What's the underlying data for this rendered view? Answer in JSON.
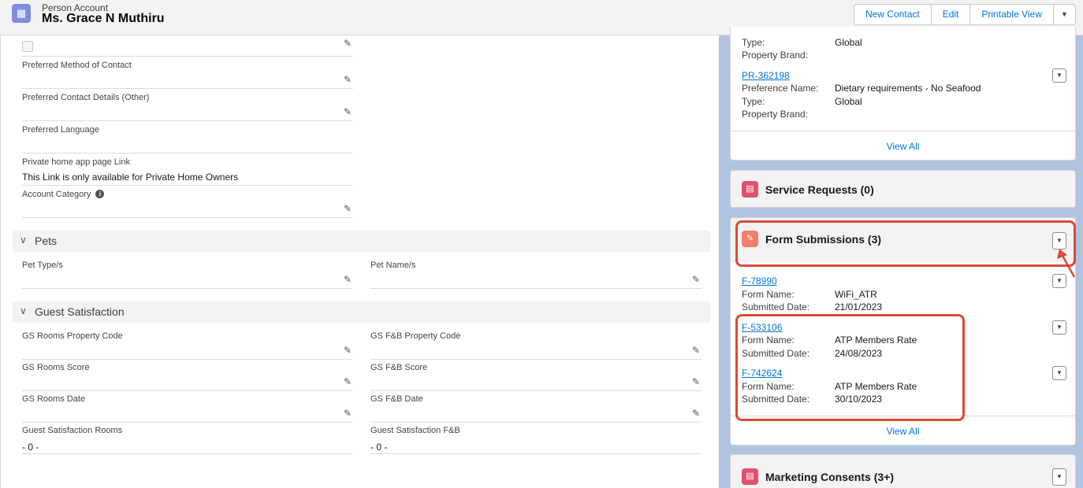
{
  "header": {
    "object_type": "Person Account",
    "record_name": "Ms. Grace N Muthiru",
    "buttons": [
      "New Contact",
      "Edit",
      "Printable View"
    ]
  },
  "details": {
    "fields": [
      {
        "label": "Preferred Method of Contact",
        "value": ""
      },
      {
        "label": "Preferred Contact Details (Other)",
        "value": ""
      },
      {
        "label": "Preferred Language",
        "value": ""
      },
      {
        "label": "Private home app page Link",
        "value": "This Link is only available for Private Home Owners"
      },
      {
        "label": "Account Category",
        "value": ""
      }
    ],
    "pets": {
      "title": "Pets",
      "fields": [
        {
          "label": "Pet Type/s",
          "value": ""
        },
        {
          "label": "Pet Name/s",
          "value": ""
        }
      ]
    },
    "guest_satisfaction": {
      "title": "Guest Satisfaction",
      "fields": [
        {
          "label": "GS Rooms Property Code",
          "value": ""
        },
        {
          "label": "GS F&B Property Code",
          "value": ""
        },
        {
          "label": "GS Rooms Score",
          "value": ""
        },
        {
          "label": "GS F&B Score",
          "value": ""
        },
        {
          "label": "GS Rooms Date",
          "value": ""
        },
        {
          "label": "GS F&B Date",
          "value": ""
        },
        {
          "label": "Guest Satisfaction Rooms",
          "value": "- 0 -"
        },
        {
          "label": "Guest Satisfaction F&B",
          "value": "- 0 -"
        }
      ]
    }
  },
  "preferences_card": {
    "top_item": {
      "type_label": "Type:",
      "type_value": "Global",
      "brand_label": "Property Brand:"
    },
    "item": {
      "id": "PR-362198",
      "name_label": "Preference Name:",
      "name_value": "Dietary requirements - No Seafood",
      "type_label": "Type:",
      "type_value": "Global",
      "brand_label": "Property Brand:"
    },
    "view_all": "View All"
  },
  "service_requests": {
    "title": "Service Requests (0)"
  },
  "form_submissions": {
    "title": "Form Submissions (3)",
    "items": [
      {
        "id": "F-78990",
        "name_label": "Form Name:",
        "name_value": "WiFi_ATR",
        "date_label": "Submitted Date:",
        "date_value": "21/01/2023"
      },
      {
        "id": "F-533106",
        "name_label": "Form Name:",
        "name_value": "ATP Members Rate",
        "date_label": "Submitted Date:",
        "date_value": "24/08/2023"
      },
      {
        "id": "F-742624",
        "name_label": "Form Name:",
        "name_value": "ATP Members Rate",
        "date_label": "Submitted Date:",
        "date_value": "30/10/2023"
      }
    ],
    "view_all": "View All"
  },
  "marketing_consents": {
    "title": "Marketing Consents (3+)"
  },
  "colors": {
    "brand": "#0176d3",
    "highlight": "#dc4a38",
    "service_icon": "#e0516b",
    "form_icon": "#f0806c"
  }
}
